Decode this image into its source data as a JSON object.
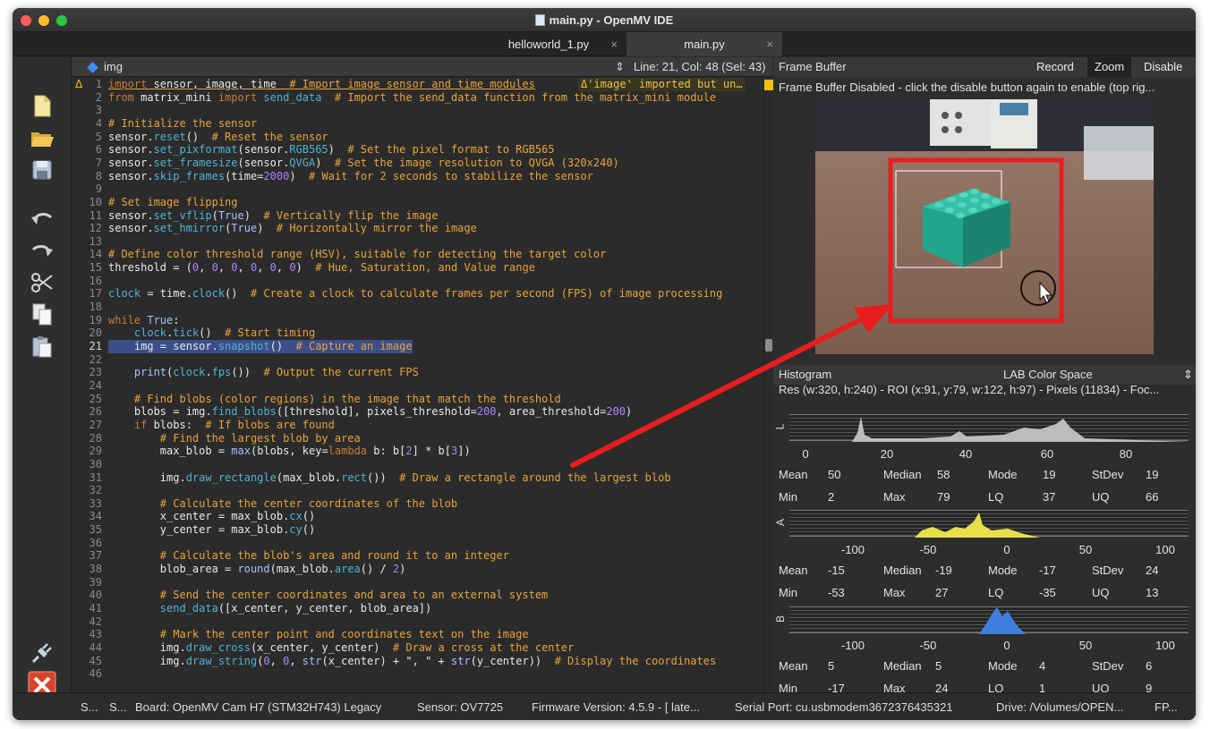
{
  "window": {
    "title": "main.py - OpenMV IDE",
    "traffic_lights": {
      "close": "#ff5f57",
      "minimize": "#febc2e",
      "zoom": "#28c840"
    }
  },
  "tabs": [
    {
      "label": "helloworld_1.py",
      "close": "×",
      "active": false
    },
    {
      "label": "main.py",
      "close": "×",
      "active": true
    }
  ],
  "toolbar": {
    "icons": [
      "new-file-icon",
      "open-folder-icon",
      "save-icon",
      "undo-icon",
      "redo-icon",
      "cut-icon",
      "copy-icon",
      "paste-icon",
      "connect-icon",
      "stop-icon"
    ]
  },
  "editor": {
    "breadcrumb_symbol": "img",
    "updown": "⇕",
    "position": "Line: 21, Col: 48 (Sel: 43)",
    "warning_marker": "Δ",
    "warning_message": "Δ'image' imported but un…",
    "current_line": 21,
    "lines": [
      {
        "n": "1",
        "code": "import sensor, image, time  # Import image sensor and time modules"
      },
      {
        "n": "2",
        "code": "from matrix_mini import send_data  # Import the send_data function from the matrix_mini module"
      },
      {
        "n": "3",
        "code": ""
      },
      {
        "n": "4",
        "code": "# Initialize the sensor"
      },
      {
        "n": "5",
        "code": "sensor.reset()  # Reset the sensor"
      },
      {
        "n": "6",
        "code": "sensor.set_pixformat(sensor.RGB565)  # Set the pixel format to RGB565"
      },
      {
        "n": "7",
        "code": "sensor.set_framesize(sensor.QVGA)  # Set the image resolution to QVGA (320x240)"
      },
      {
        "n": "8",
        "code": "sensor.skip_frames(time=2000)  # Wait for 2 seconds to stabilize the sensor"
      },
      {
        "n": "9",
        "code": ""
      },
      {
        "n": "10",
        "code": "# Set image flipping"
      },
      {
        "n": "11",
        "code": "sensor.set_vflip(True)  # Vertically flip the image"
      },
      {
        "n": "12",
        "code": "sensor.set_hmirror(True)  # Horizontally mirror the image"
      },
      {
        "n": "13",
        "code": ""
      },
      {
        "n": "14",
        "code": "# Define color threshold range (HSV), suitable for detecting the target color"
      },
      {
        "n": "15",
        "code": "threshold = (0, 0, 0, 0, 0, 0)  # Hue, Saturation, and Value range"
      },
      {
        "n": "16",
        "code": ""
      },
      {
        "n": "17",
        "code": "clock = time.clock()  # Create a clock to calculate frames per second (FPS) of image processing"
      },
      {
        "n": "18",
        "code": ""
      },
      {
        "n": "19",
        "code": "while True:"
      },
      {
        "n": "20",
        "code": "    clock.tick()  # Start timing"
      },
      {
        "n": "21",
        "code": "    img = sensor.snapshot()  # Capture an image"
      },
      {
        "n": "22",
        "code": ""
      },
      {
        "n": "23",
        "code": "    print(clock.fps())  # Output the current FPS"
      },
      {
        "n": "24",
        "code": ""
      },
      {
        "n": "25",
        "code": "    # Find blobs (color regions) in the image that match the threshold"
      },
      {
        "n": "26",
        "code": "    blobs = img.find_blobs([threshold], pixels_threshold=200, area_threshold=200)"
      },
      {
        "n": "27",
        "code": "    if blobs:  # If blobs are found"
      },
      {
        "n": "28",
        "code": "        # Find the largest blob by area"
      },
      {
        "n": "29",
        "code": "        max_blob = max(blobs, key=lambda b: b[2] * b[3])"
      },
      {
        "n": "30",
        "code": ""
      },
      {
        "n": "31",
        "code": "        img.draw_rectangle(max_blob.rect())  # Draw a rectangle around the largest blob"
      },
      {
        "n": "32",
        "code": ""
      },
      {
        "n": "33",
        "code": "        # Calculate the center coordinates of the blob"
      },
      {
        "n": "34",
        "code": "        x_center = max_blob.cx()"
      },
      {
        "n": "35",
        "code": "        y_center = max_blob.cy()"
      },
      {
        "n": "36",
        "code": ""
      },
      {
        "n": "37",
        "code": "        # Calculate the blob's area and round it to an integer"
      },
      {
        "n": "38",
        "code": "        blob_area = round(max_blob.area() / 2)"
      },
      {
        "n": "39",
        "code": ""
      },
      {
        "n": "40",
        "code": "        # Send the center coordinates and area to an external system"
      },
      {
        "n": "41",
        "code": "        send_data([x_center, y_center, blob_area])"
      },
      {
        "n": "42",
        "code": ""
      },
      {
        "n": "43",
        "code": "        # Mark the center point and coordinates text on the image"
      },
      {
        "n": "44",
        "code": "        img.draw_cross(x_center, y_center)  # Draw a cross at the center"
      },
      {
        "n": "45",
        "code": "        img.draw_string(0, 0, str(x_center) + \", \" + str(y_center))  # Display the coordinates"
      },
      {
        "n": "46",
        "code": ""
      }
    ]
  },
  "frame_buffer": {
    "title": "Frame Buffer",
    "buttons": [
      "Record",
      "Zoom",
      "Disable"
    ],
    "active_button": "Zoom",
    "message": "Frame Buffer Disabled - click the disable button again to enable (top rig..."
  },
  "histogram": {
    "title": "Histogram",
    "color_space": "LAB Color Space",
    "color_space_arrow": "⇕",
    "info": "Res (w:320, h:240) - ROI (x:91, y:79, w:122, h:97) - Pixels (11834) - Foc...",
    "channels": [
      {
        "label": "L",
        "color": "#bdbdbd",
        "ticks": [
          "0",
          "20",
          "40",
          "60",
          "80"
        ],
        "stats": [
          [
            "Mean",
            "50",
            "Median",
            "58",
            "Mode",
            "19",
            "StDev",
            "19"
          ],
          [
            "Min",
            "2",
            "Max",
            "79",
            "LQ",
            "37",
            "UQ",
            "66"
          ]
        ]
      },
      {
        "label": "A",
        "color": "#e8e04a",
        "ticks": [
          "-100",
          "-50",
          "0",
          "50",
          "100"
        ],
        "stats": [
          [
            "Mean",
            "-15",
            "Median",
            "-19",
            "Mode",
            "-17",
            "StDev",
            "24"
          ],
          [
            "Min",
            "-53",
            "Max",
            "27",
            "LQ",
            "-35",
            "UQ",
            "13"
          ]
        ]
      },
      {
        "label": "B",
        "color": "#3f7fe0",
        "ticks": [
          "-100",
          "-50",
          "0",
          "50",
          "100"
        ],
        "stats": [
          [
            "Mean",
            "5",
            "Median",
            "5",
            "Mode",
            "4",
            "StDev",
            "6"
          ],
          [
            "Min",
            "-17",
            "Max",
            "24",
            "LQ",
            "1",
            "UQ",
            "9"
          ]
        ]
      }
    ]
  },
  "status_bar": {
    "items": [
      "S...",
      "S...",
      "Board: OpenMV Cam H7 (STM32H743) Legacy",
      "Sensor: OV7725",
      "Firmware Version: 4.5.9 - [ late...",
      "Serial Port: cu.usbmodem3672376435321",
      "Drive: /Volumes/OPEN...",
      "FP..."
    ]
  }
}
